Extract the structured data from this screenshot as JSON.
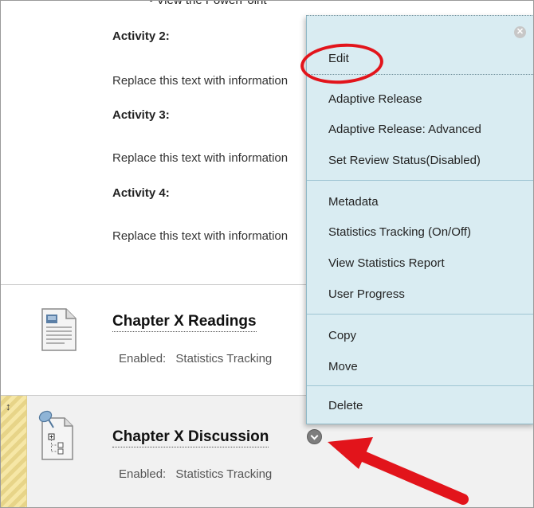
{
  "content": {
    "cut_text": "• View the PowerPoint",
    "activities": [
      {
        "heading": "Activity 2:",
        "text": "Replace this text with information"
      },
      {
        "heading": "Activity 3:",
        "text": "Replace this text with information"
      },
      {
        "heading": "Activity 4:",
        "text": "Replace this text with information"
      }
    ]
  },
  "items": [
    {
      "title": "Chapter X Readings",
      "enabled_label": "Enabled:",
      "enabled_value": "Statistics Tracking"
    },
    {
      "title": "Chapter X Discussion",
      "enabled_label": "Enabled:",
      "enabled_value": "Statistics Tracking"
    }
  ],
  "context_menu": {
    "close_symbol": "✕",
    "items": [
      "Edit",
      "Adaptive Release",
      "Adaptive Release: Advanced",
      "Set Review Status(Disabled)",
      "Metadata",
      "Statistics Tracking (On/Off)",
      "View Statistics Report",
      "User Progress",
      "Copy",
      "Move",
      "Delete"
    ]
  },
  "drag_handle_symbol": "↕",
  "colors": {
    "menu_bg": "#d9ecf2",
    "annotation_red": "#e2141b",
    "drag_strip": "#f6e7a6"
  }
}
